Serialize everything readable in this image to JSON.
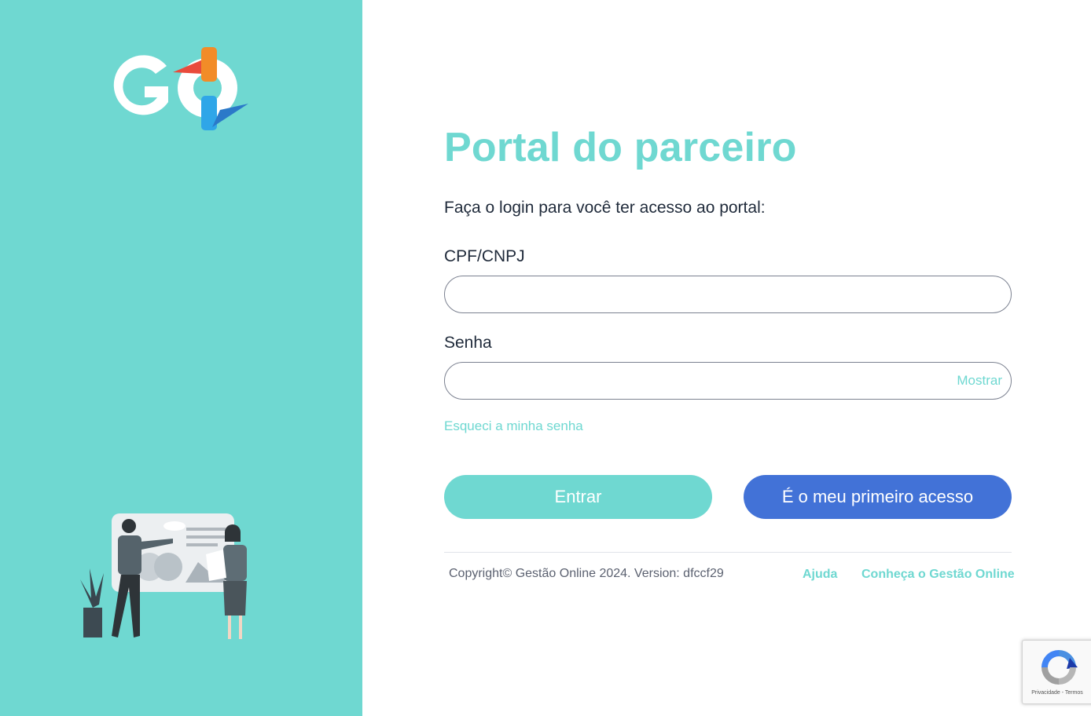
{
  "brand": {
    "logo_text": "GO",
    "colors": {
      "accent": "#6fd8d1",
      "primary_button": "#4272d7",
      "logo_orange": "#f28c28",
      "logo_blue": "#2fa6e8",
      "logo_red": "#e94b3c"
    }
  },
  "login": {
    "title": "Portal do parceiro",
    "subtitle": "Faça o login para você ter acesso ao portal:",
    "cpf_label": "CPF/CNPJ",
    "cpf_value": "",
    "password_label": "Senha",
    "password_value": "",
    "show_password_label": "Mostrar",
    "forgot_password_label": "Esqueci a minha senha",
    "enter_button_label": "Entrar",
    "first_access_button_label": "É o meu primeiro acesso"
  },
  "footer": {
    "copyright": "Copyright© Gestão Online 2024. Version: dfccf29",
    "help_link": "Ajuda",
    "know_link": "Conheça o Gestão Online"
  },
  "recaptcha": {
    "icon": "recaptcha-icon",
    "terms_text": "Privacidade - Termos"
  },
  "illustration": {
    "icon": "business-people-presentation-illustration"
  }
}
